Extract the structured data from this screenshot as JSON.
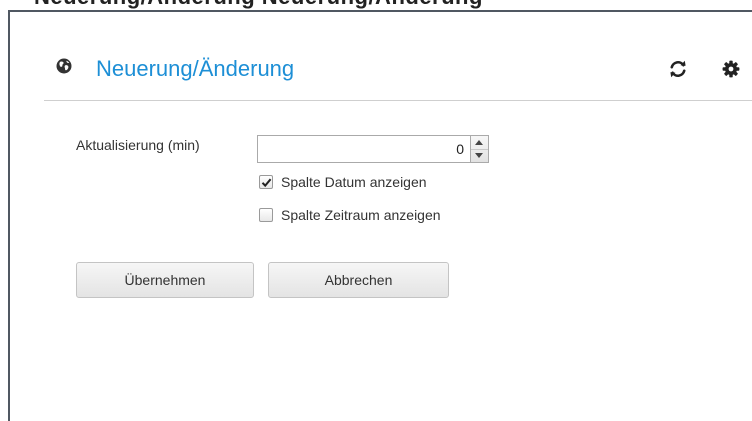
{
  "top_strip": {
    "text": "Neuerung/Änderung Neuerung/Änderung"
  },
  "widget": {
    "title": "Neuerung/Änderung",
    "icons": {
      "title_icon": "globe-icon",
      "refresh": "refresh-icon",
      "settings": "gear-icon"
    }
  },
  "form": {
    "refresh_label": "Aktualisierung (min)",
    "refresh_value": "0",
    "show_date_label": "Spalte Datum anzeigen",
    "show_date_checked": true,
    "show_period_label": "Spalte Zeitraum anzeigen",
    "show_period_checked": false
  },
  "buttons": {
    "apply": "Übernehmen",
    "cancel": "Abbrechen"
  },
  "colors": {
    "title": "#1d8fd6",
    "frame_border": "#505862"
  }
}
